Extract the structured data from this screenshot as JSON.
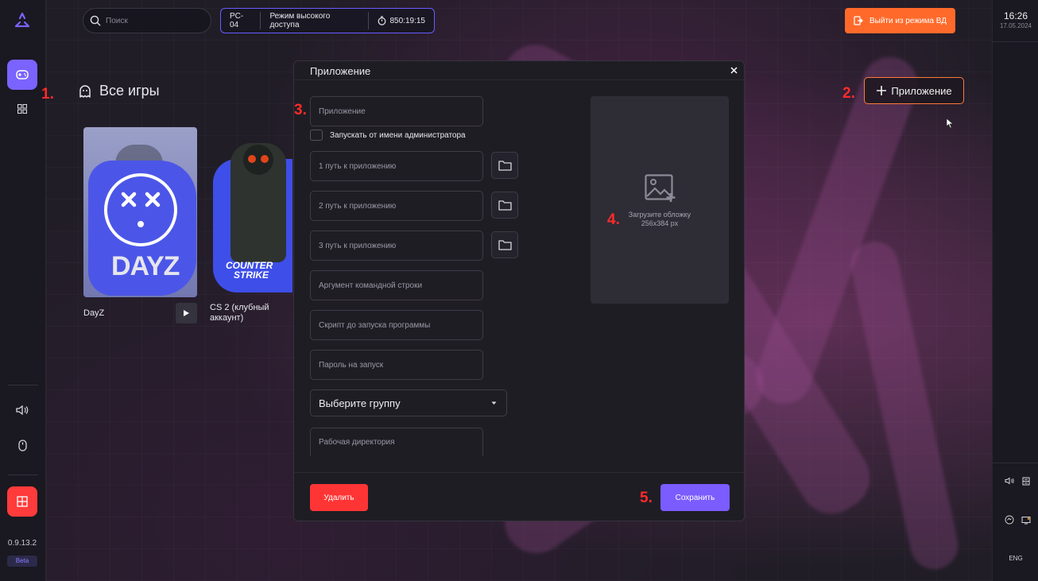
{
  "search": {
    "placeholder": "Поиск"
  },
  "status_bar": {
    "pc_name": "PC-04",
    "mode": "Режим высокого доступа",
    "timer": "850:19:15"
  },
  "exit_button": {
    "label": "Выйти из режима ВД",
    "color": "#ff6a2b"
  },
  "page": {
    "title": "Все игры"
  },
  "add_app_button": {
    "label": "Приложение"
  },
  "markers": {
    "m1": "1.",
    "m2": "2.",
    "m3": "3.",
    "m4": "4.",
    "m5": "5."
  },
  "games": [
    {
      "name": "DayZ",
      "cover_word": "DAYZ"
    },
    {
      "name": "CS 2 (клубный аккаунт)",
      "cover_word_1": "COUNTER",
      "cover_word_2": "STRIKE"
    }
  ],
  "sidebar": {
    "version": "0.9.13.2",
    "badge": "Beta"
  },
  "rightbar": {
    "time": "16:26",
    "date": "17.05.2024",
    "language": "ENG"
  },
  "modal": {
    "title": "Приложение",
    "fields": {
      "app_name": "Приложение",
      "run_as_admin": "Запускать от имени администратора",
      "path1": "1 путь к приложению",
      "path2": "2 путь к приложению",
      "path3": "3 путь к приложению",
      "args": "Аргумент командной строки",
      "script": "Скрипт до запуска программы",
      "password": "Пароль на запуск",
      "group": "Выберите группу",
      "workdir": "Рабочая директория"
    },
    "cover": {
      "line1": "Загрузите обложку",
      "line2": "256x384 px"
    },
    "delete_label": "Удалить",
    "save_label": "Сохранить"
  },
  "colors": {
    "accent": "#7a5cff",
    "danger": "#ff3535",
    "marker": "#ff2b2b"
  }
}
